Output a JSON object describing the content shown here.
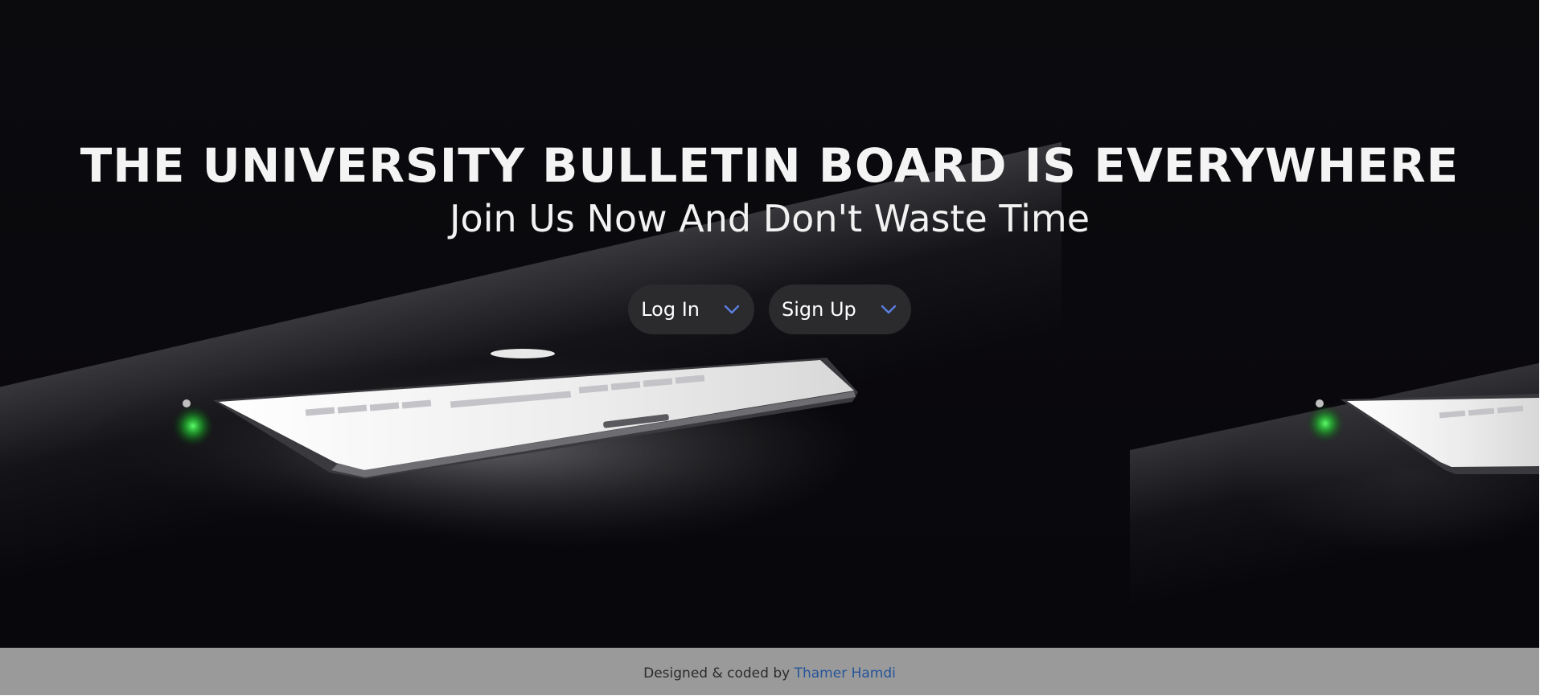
{
  "hero": {
    "title": "THE UNIVERSITY BULLETIN BOARD IS EVERYWHERE",
    "subtitle": "Join Us Now And Don't Waste Time",
    "background": "dark photo of glowing laptop on desk"
  },
  "buttons": {
    "login_label": "Log In",
    "signup_label": "Sign Up",
    "chevron_icon": "chevron-down-icon"
  },
  "footer": {
    "credit_prefix": "Designed & coded by",
    "author_name": "Thamer Hamdi"
  },
  "colors": {
    "hero_bg": "#0a090d",
    "pill_bg": "#2b2b2d",
    "chevron": "#5b7fe0",
    "footer_bg": "#9a9a9a",
    "author_link": "#25549a"
  }
}
